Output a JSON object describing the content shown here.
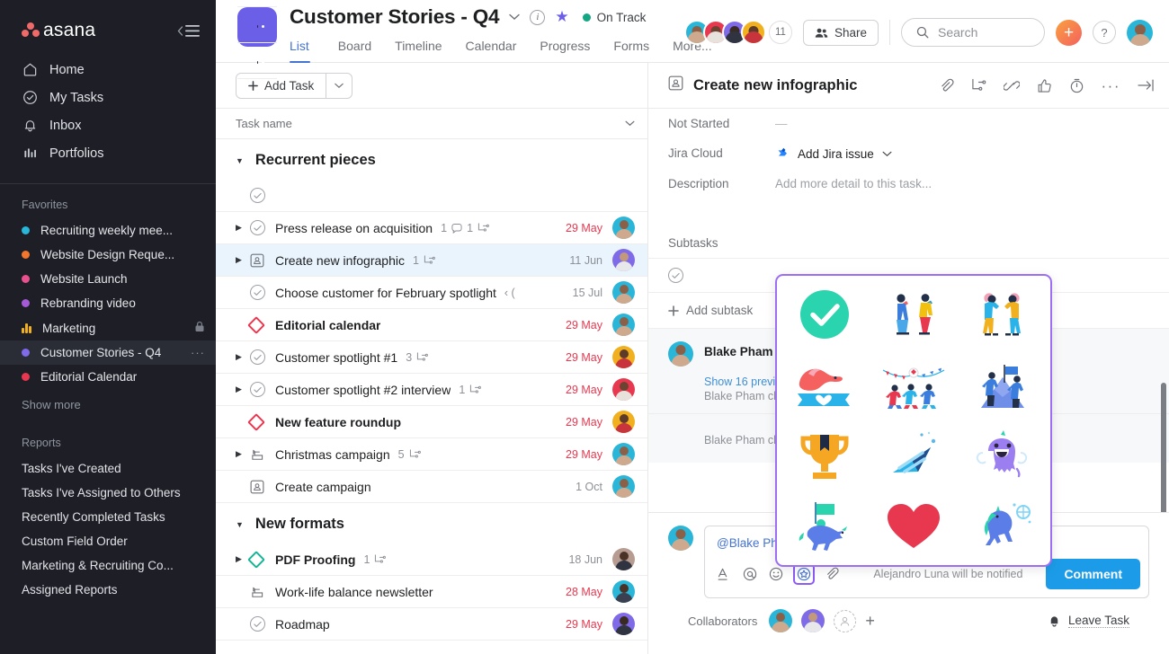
{
  "sidebar": {
    "brand": "asana",
    "nav": [
      {
        "label": "Home",
        "icon": "home-icon"
      },
      {
        "label": "My Tasks",
        "icon": "check-circle-icon"
      },
      {
        "label": "Inbox",
        "icon": "bell-icon"
      },
      {
        "label": "Portfolios",
        "icon": "bars-icon"
      }
    ],
    "favorites_title": "Favorites",
    "favorites": [
      {
        "label": "Recruiting weekly mee...",
        "color": "#29b6d8",
        "type": "dot"
      },
      {
        "label": "Website Design Reque...",
        "color": "#f2762e",
        "type": "dot"
      },
      {
        "label": "Website Launch",
        "color": "#e8518e",
        "type": "dot"
      },
      {
        "label": "Rebranding video",
        "color": "#a55ad8",
        "type": "dot"
      },
      {
        "label": "Marketing",
        "color": "#f1b01e",
        "type": "bars",
        "locked": true
      },
      {
        "label": "Customer Stories - Q4",
        "color": "#7f6ae8",
        "type": "dot",
        "active": true,
        "more": "···"
      },
      {
        "label": "Editorial Calendar",
        "color": "#e8384f",
        "type": "dot"
      }
    ],
    "show_more": "Show more",
    "reports_title": "Reports",
    "reports": [
      "Tasks I've Created",
      "Tasks I've Assigned to Others",
      "Recently Completed Tasks",
      "Custom Field Order",
      "Marketing & Recruiting Co...",
      "Assigned Reports"
    ]
  },
  "header": {
    "project_title": "Customer Stories - Q4",
    "status_label": "On Track",
    "status_color": "#14a683",
    "tabs": [
      {
        "label": "List",
        "active": true
      },
      {
        "label": "Board",
        "active": false
      },
      {
        "label": "Timeline",
        "active": false
      },
      {
        "label": "Calendar",
        "active": false
      },
      {
        "label": "Progress",
        "active": false
      },
      {
        "label": "Forms",
        "active": false
      },
      {
        "label": "More...",
        "active": false
      }
    ],
    "member_count": "11",
    "share_label": "Share",
    "search_placeholder": "Search",
    "help_label": "?",
    "plus_label": "+",
    "accent_color": "#4573d2"
  },
  "list": {
    "add_task_label": "Add Task",
    "column_header": "Task name",
    "groups": [
      {
        "name": "Recurrent pieces",
        "tasks": [
          {
            "name": "",
            "icon": "check-circle-icon",
            "date": "",
            "empty": true
          },
          {
            "name": "Press release on acquisition",
            "icon": "check-circle-icon",
            "expand": true,
            "comments": "1",
            "subtasks": "1",
            "date": "29 May",
            "due": true,
            "avatar": "#29b6d8"
          },
          {
            "name": "Create new infographic",
            "icon": "approval-icon",
            "expand": true,
            "subtasks": "1",
            "date": "11 Jun",
            "due": false,
            "avatar": "#7f6ae8",
            "selected": true
          },
          {
            "name": "Choose customer for February spotlight",
            "icon": "check-circle-icon",
            "extra": "‹ (",
            "date": "15 Jul",
            "due": false,
            "avatar": "#29b6d8"
          },
          {
            "name": "Editorial calendar",
            "icon": "milestone-icon",
            "bold": true,
            "date": "29 May",
            "due": true,
            "avatar": "#29b6d8"
          },
          {
            "name": "Customer spotlight #1",
            "icon": "check-circle-icon",
            "expand": true,
            "subtasks": "3",
            "date": "29 May",
            "due": true,
            "avatar": "#f1b01e"
          },
          {
            "name": "Customer spotlight #2 interview",
            "icon": "check-circle-icon",
            "expand": true,
            "subtasks": "1",
            "date": "29 May",
            "due": true,
            "avatar": "#e8384f"
          },
          {
            "name": "New feature roundup",
            "icon": "milestone-icon",
            "bold": true,
            "date": "29 May",
            "due": true,
            "avatar": "#f1b01e"
          },
          {
            "name": "Christmas campaign",
            "icon": "approval-alt-icon",
            "expand": true,
            "subtasks": "5",
            "date": "29 May",
            "due": true,
            "avatar": "#29b6d8"
          },
          {
            "name": "Create campaign",
            "icon": "approval-icon",
            "date": "1 Oct",
            "due": false,
            "avatar": "#29b6d8"
          }
        ]
      },
      {
        "name": "New formats",
        "tasks": [
          {
            "name": "PDF Proofing",
            "icon": "milestone-green-icon",
            "bold": true,
            "expand": true,
            "subtasks": "1",
            "date": "18 Jun",
            "due": false,
            "avatar": "#8a6148"
          },
          {
            "name": "Work-life balance newsletter",
            "icon": "approval-alt-icon",
            "date": "28 May",
            "due": true,
            "avatar": "#29b6d8"
          },
          {
            "name": "Roadmap",
            "icon": "check-circle-icon",
            "date": "29 May",
            "due": true,
            "avatar": "#7f6ae8"
          }
        ]
      }
    ]
  },
  "detail": {
    "title": "Create new infographic",
    "header_icons": [
      "attachment-icon",
      "subtask-icon",
      "link-icon",
      "like-icon",
      "timer-icon",
      "more-icon",
      "collapse-icon"
    ],
    "fields": [
      {
        "key": "Not Started",
        "value": "—",
        "type": "text"
      },
      {
        "key": "Jira Cloud",
        "value": "Add Jira issue",
        "type": "jira"
      },
      {
        "key": "Description",
        "value": "Add more detail to this task...",
        "type": "placeholder"
      }
    ],
    "subtasks_label": "Subtasks",
    "add_subtask_label": "Add subtask",
    "stories": [
      {
        "author": "Blake Pham",
        "text": "Blake Pham c"
      },
      {
        "link": "Show 16 previo",
        "line": "Blake Pham cha"
      },
      {
        "line": "Blake Pham cha"
      }
    ],
    "composer": {
      "mention": "@Blake Pha",
      "tools": [
        "format-icon",
        "mention-icon",
        "emoji-icon",
        "sticker-icon",
        "attachment-icon"
      ],
      "notify": "Alejandro Luna will be notified",
      "submit_label": "Comment"
    },
    "collaborators_label": "Collaborators",
    "leave_task_label": "Leave Task"
  },
  "sticker_popup": {
    "border_color": "#9b6ef3",
    "stickers": [
      "check-circle-sticker",
      "celebration-people-sticker",
      "cheering-people-sticker",
      "dove-banner-sticker",
      "party-bunting-sticker",
      "mountain-flag-sticker",
      "trophy-sticker",
      "party-hat-sticker",
      "narwhal-sticker",
      "unicorn-rider-sticker",
      "heart-sticker",
      "unicorn-sticker"
    ]
  }
}
